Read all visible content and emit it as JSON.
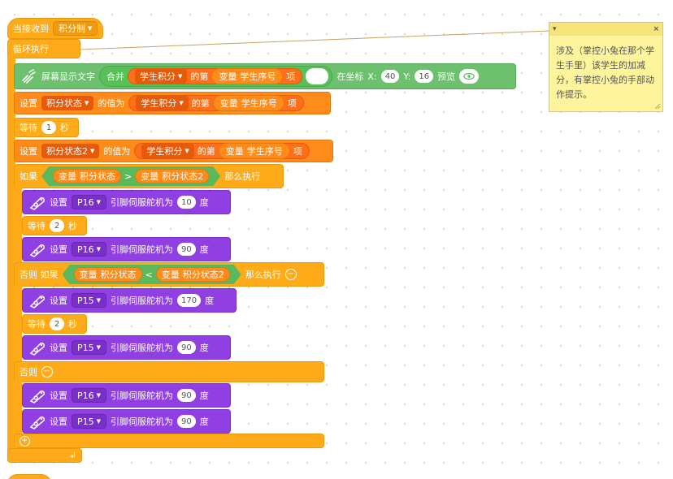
{
  "hat": {
    "label": "当接收到",
    "message": "积分制"
  },
  "loop": {
    "label": "循环执行"
  },
  "display": {
    "label": "屏幕显示文字",
    "join": "合并",
    "list": "学生积分",
    "nth": "的第",
    "var_prefix": "变量",
    "var_name": "学生序号",
    "item": "项",
    "pos": "在坐标",
    "x_label": "X:",
    "x": "40",
    "y_label": "Y:",
    "y": "16",
    "preview": "预览"
  },
  "set1": {
    "set": "设置",
    "var": "积分状态",
    "value_of": "的值为",
    "list": "学生积分",
    "nth": "的第",
    "var_prefix": "变量",
    "var_name": "学生序号",
    "item": "项"
  },
  "wait1": {
    "label": "等待",
    "value": "1",
    "unit": "秒"
  },
  "set2": {
    "set": "设置",
    "var": "积分状态2",
    "value_of": "的值为",
    "list": "学生积分",
    "nth": "的第",
    "var_prefix": "变量",
    "var_name": "学生序号",
    "item": "项"
  },
  "if1": {
    "label": "如果",
    "var_prefix": "变量",
    "left": "积分状态",
    "op": ">",
    "right": "积分状态2",
    "then": "那么执行"
  },
  "servo_a": {
    "set": "设置",
    "pin": "P16",
    "text": "引脚伺服舵机为",
    "value": "10",
    "unit": "度"
  },
  "wait2": {
    "label": "等待",
    "value": "2",
    "unit": "秒"
  },
  "servo_b": {
    "set": "设置",
    "pin": "P16",
    "text": "引脚伺服舵机为",
    "value": "90",
    "unit": "度"
  },
  "elseif": {
    "label": "否则 如果",
    "var_prefix": "变量",
    "left": "积分状态",
    "op": "<",
    "right": "积分状态2",
    "then": "那么执行"
  },
  "servo_c": {
    "set": "设置",
    "pin": "P15",
    "text": "引脚伺服舵机为",
    "value": "170",
    "unit": "度"
  },
  "wait3": {
    "label": "等待",
    "value": "2",
    "unit": "秒"
  },
  "servo_d": {
    "set": "设置",
    "pin": "P15",
    "text": "引脚伺服舵机为",
    "value": "90",
    "unit": "度"
  },
  "else": {
    "label": "否则"
  },
  "servo_e": {
    "set": "设置",
    "pin": "P16",
    "text": "引脚伺服舵机为",
    "value": "90",
    "unit": "度"
  },
  "servo_f": {
    "set": "设置",
    "pin": "P15",
    "text": "引脚伺服舵机为",
    "value": "90",
    "unit": "度"
  },
  "comment": {
    "text": "涉及（掌控小兔在那个学生手里）该学生的加减分，有掌控小兔的手部动作提示。",
    "close": "×",
    "collapse": "▾"
  },
  "colors": {
    "events": "#FFAB19",
    "looks": "#6DC06D",
    "variables": "#FF8C1A",
    "servo": "#8F3FE2",
    "operators": "#5CB85C",
    "comment": "#FEF49C"
  }
}
